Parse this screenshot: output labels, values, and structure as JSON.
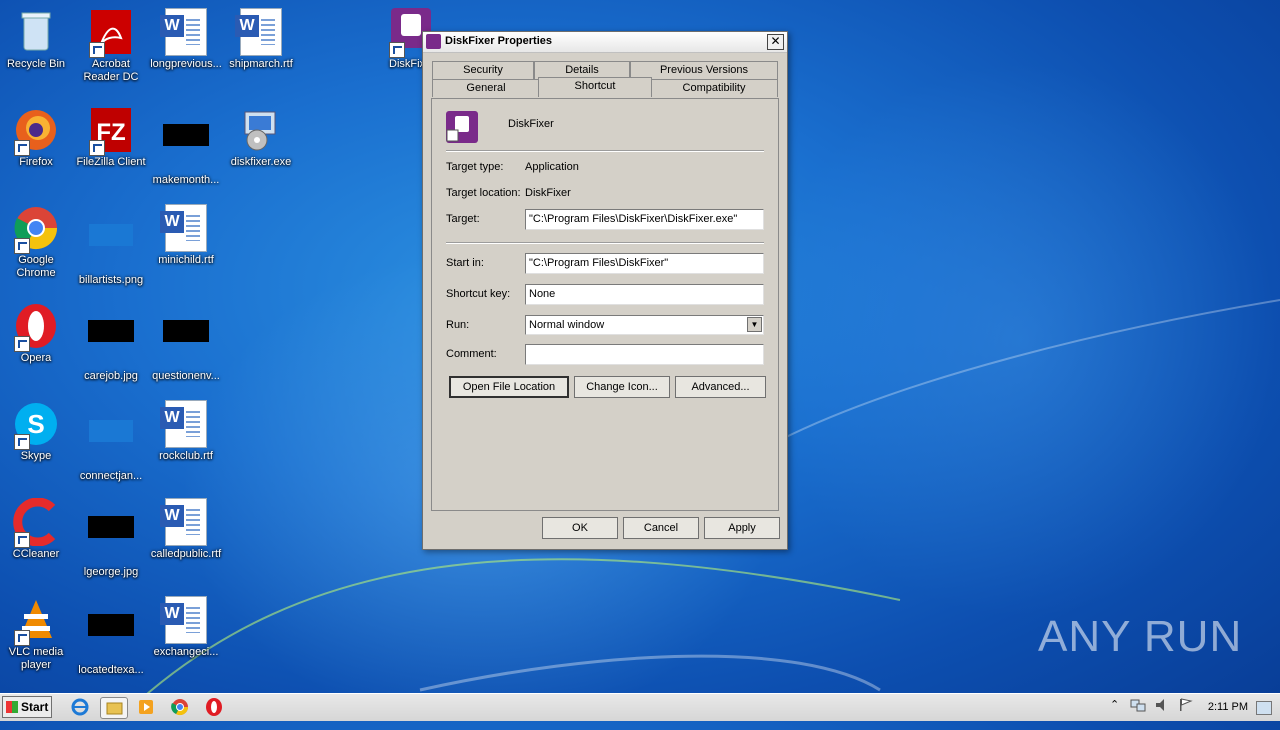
{
  "desktop": {
    "icons": [
      {
        "label": "Recycle Bin"
      },
      {
        "label": "Acrobat Reader DC"
      },
      {
        "label": "longprevious..."
      },
      {
        "label": "shipmarch.rtf"
      },
      {
        "label": "DiskFix"
      },
      {
        "label": "Firefox"
      },
      {
        "label": "FileZilla Client"
      },
      {
        "label": "makemonth..."
      },
      {
        "label": "diskfixer.exe"
      },
      {
        "label": "Google Chrome"
      },
      {
        "label": "billartists.png"
      },
      {
        "label": "minichild.rtf"
      },
      {
        "label": "Opera"
      },
      {
        "label": "carejob.jpg"
      },
      {
        "label": "questionenv..."
      },
      {
        "label": "Skype"
      },
      {
        "label": "connectjan..."
      },
      {
        "label": "rockclub.rtf"
      },
      {
        "label": "CCleaner"
      },
      {
        "label": "lgeorge.jpg"
      },
      {
        "label": "calledpublic.rtf"
      },
      {
        "label": "VLC media player"
      },
      {
        "label": "locatedtexa..."
      },
      {
        "label": "exchangeci..."
      }
    ]
  },
  "dialog": {
    "title": "DiskFixer Properties",
    "close_glyph": "✕",
    "tabs_top": [
      "Security",
      "Details",
      "Previous Versions"
    ],
    "tabs_bottom": [
      "General",
      "Shortcut",
      "Compatibility"
    ],
    "active_tab": "Shortcut",
    "app_name": "DiskFixer",
    "target_type_label": "Target type:",
    "target_type_value": "Application",
    "target_location_label": "Target location:",
    "target_location_value": "DiskFixer",
    "target_label": "Target:",
    "target_value": "\"C:\\Program Files\\DiskFixer\\DiskFixer.exe\"",
    "start_in_label": "Start in:",
    "start_in_value": "\"C:\\Program Files\\DiskFixer\"",
    "shortcut_key_label": "Shortcut key:",
    "shortcut_key_value": "None",
    "run_label": "Run:",
    "run_value": "Normal window",
    "comment_label": "Comment:",
    "comment_value": "",
    "open_file_location": "Open File Location",
    "change_icon": "Change Icon...",
    "advanced": "Advanced...",
    "ok": "OK",
    "cancel": "Cancel",
    "apply": "Apply"
  },
  "taskbar": {
    "start_label": "Start",
    "clock": "2:11 PM"
  },
  "watermark": "ANY RUN"
}
